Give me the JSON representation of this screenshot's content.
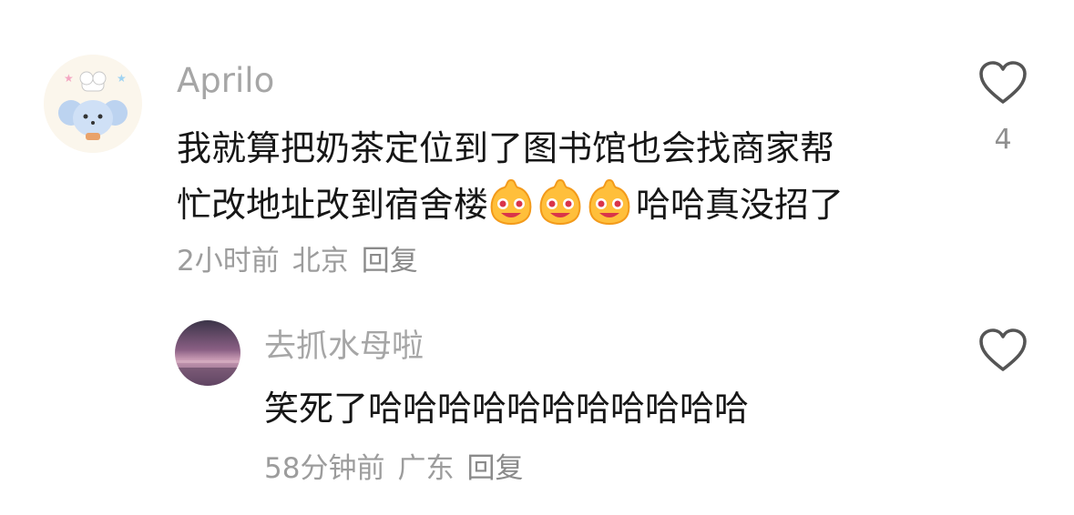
{
  "comments": [
    {
      "username": "Aprilo",
      "text_line1": "我就算把奶茶定位到了图书馆也会找商家帮",
      "text_line2_before": "忙改地址改到宿舍楼",
      "text_line2_after": "哈哈真没招了",
      "emoji_name": "laughing-bun-emoji",
      "time": "2小时前",
      "location": "北京",
      "reply_label": "回复",
      "like_count": "4"
    },
    {
      "username": "去抓水母啦",
      "text": "笑死了哈哈哈哈哈哈哈哈哈哈哈",
      "time": "58分钟前",
      "location": "广东",
      "reply_label": "回复",
      "like_count": ""
    }
  ],
  "icons": {
    "like": "heart-outline-icon"
  },
  "colors": {
    "username": "#a6a6a6",
    "text": "#161616",
    "meta": "#9c9c9c",
    "icon": "#555555"
  }
}
